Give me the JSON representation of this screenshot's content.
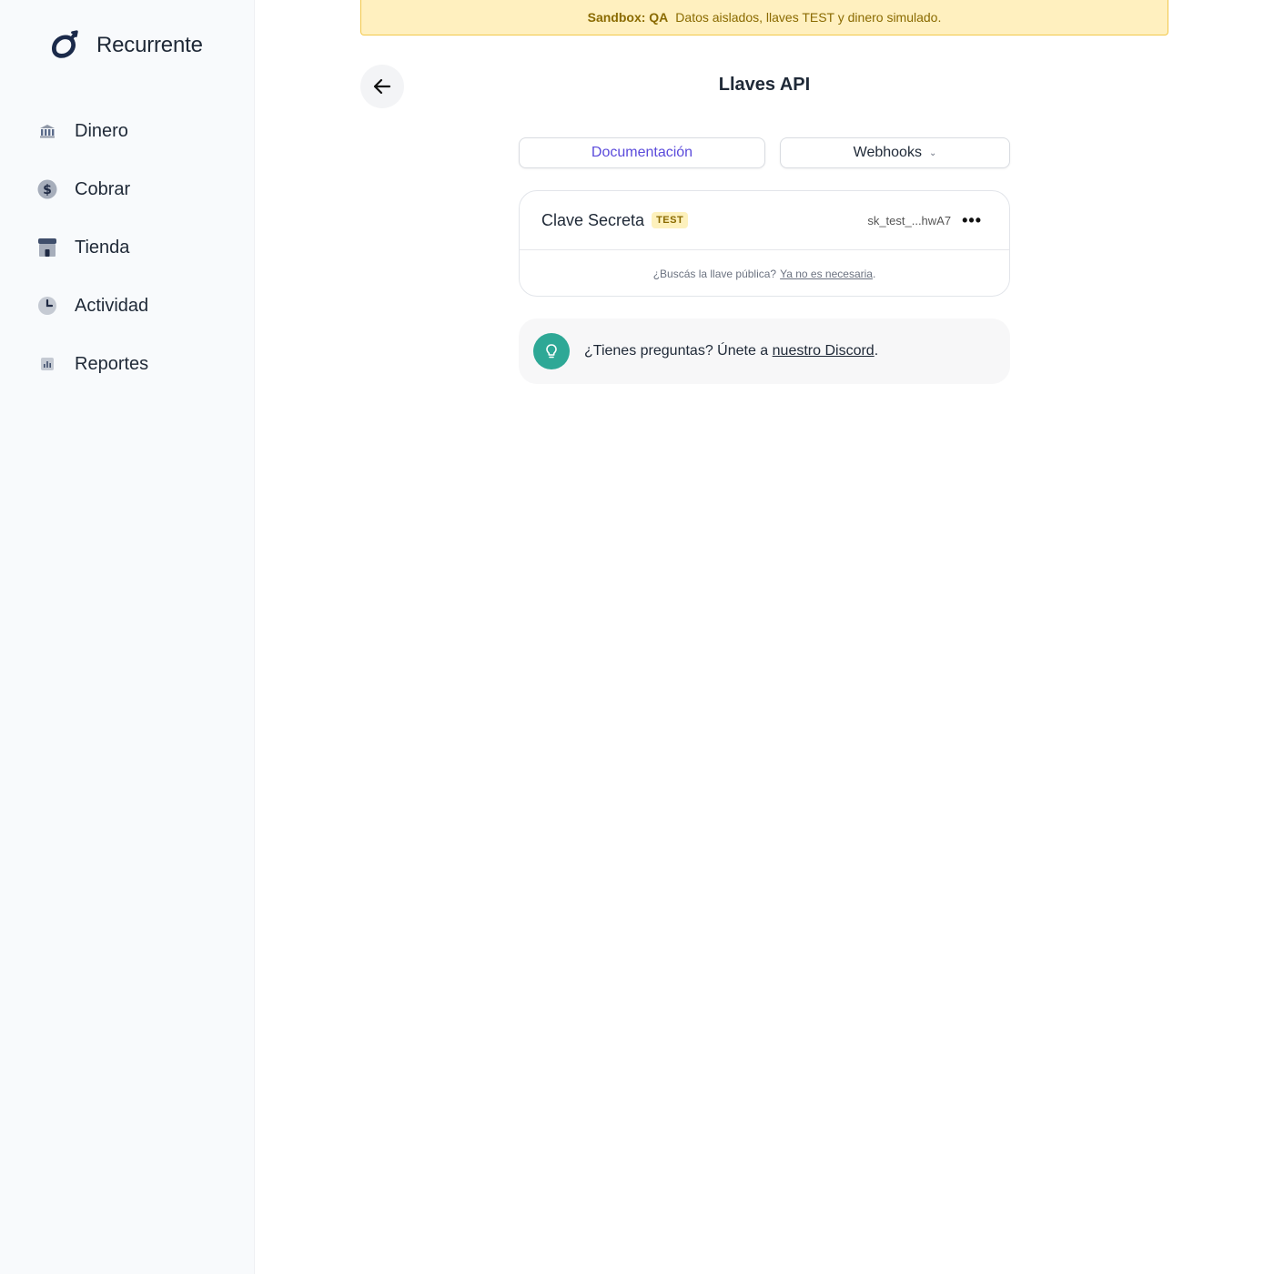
{
  "sidebar": {
    "brand": {
      "name": "Recurrente",
      "logo_icon": "recurrente-logo-icon"
    },
    "items": [
      {
        "label": "Dinero",
        "icon": "bank-icon"
      },
      {
        "label": "Cobrar",
        "icon": "dollar-icon"
      },
      {
        "label": "Tienda",
        "icon": "store-icon"
      },
      {
        "label": "Actividad",
        "icon": "clock-icon"
      },
      {
        "label": "Reportes",
        "icon": "chart-icon"
      }
    ]
  },
  "banner": {
    "label": "Sandbox: QA",
    "text": "Datos aislados, llaves TEST y dinero simulado."
  },
  "header": {
    "title": "Llaves API"
  },
  "tabs": {
    "docs": "Documentación",
    "webhooks": "Webhooks"
  },
  "key_card": {
    "title": "Clave Secreta",
    "badge": "TEST",
    "value": "sk_test_...hwA7",
    "footer_text": "¿Buscás la llave pública?",
    "footer_link": "Ya no es necesaria",
    "footer_period": "."
  },
  "help": {
    "text": "¿Tienes preguntas? Únete a ",
    "link": "nuestro Discord",
    "period": "."
  },
  "colors": {
    "accent": "#5b4bdb",
    "banner_bg": "#fff0bf",
    "help_icon_bg": "#2ea896"
  }
}
